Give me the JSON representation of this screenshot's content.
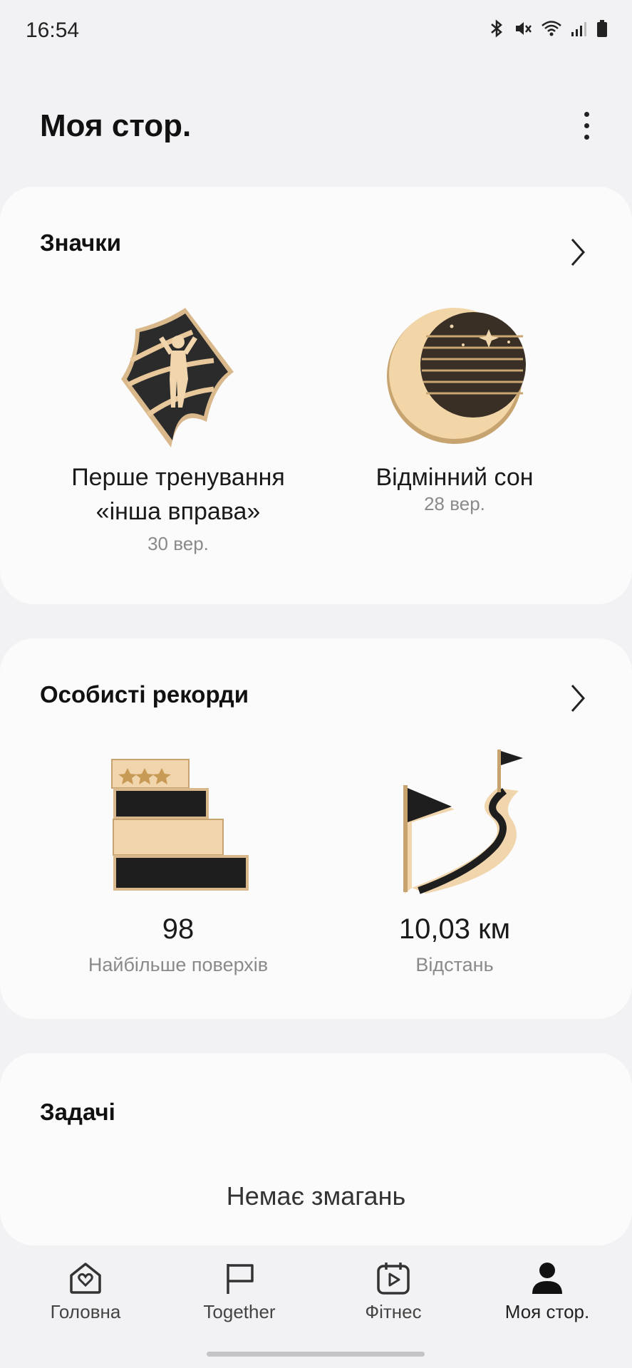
{
  "status_bar": {
    "time": "16:54",
    "icons": [
      "bluetooth-icon",
      "mute-icon",
      "wifi-icon",
      "signal-icon",
      "battery-icon"
    ]
  },
  "header": {
    "title": "Моя стор."
  },
  "badges": {
    "title": "Значки",
    "items": [
      {
        "title_line1": "Перше тренування",
        "title_line2": "«інша вправа»",
        "date": "30 вер.",
        "icon": "workout-badge-icon"
      },
      {
        "title_line1": "Відмінний сон",
        "title_line2": "",
        "date": "28 вер.",
        "icon": "sleep-moon-badge-icon"
      }
    ]
  },
  "records": {
    "title": "Особисті рекорди",
    "items": [
      {
        "value": "98",
        "label": "Найбільше поверхів",
        "icon": "floors-record-icon"
      },
      {
        "value": "10,03 км",
        "label": "Відстань",
        "icon": "distance-record-icon"
      }
    ]
  },
  "challenges": {
    "title": "Задачі",
    "empty_text": "Немає змагань"
  },
  "bottom_nav": {
    "items": [
      {
        "label": "Головна",
        "icon": "home-heart-icon"
      },
      {
        "label": "Together",
        "icon": "flag-icon"
      },
      {
        "label": "Фітнес",
        "icon": "calendar-play-icon"
      },
      {
        "label": "Моя стор.",
        "icon": "profile-icon",
        "active": true
      }
    ]
  },
  "colors": {
    "background": "#f2f2f4",
    "card": "#fbfbfc",
    "gold": "#e8c79a",
    "dark": "#222222",
    "muted_text": "#8a8a8a"
  }
}
